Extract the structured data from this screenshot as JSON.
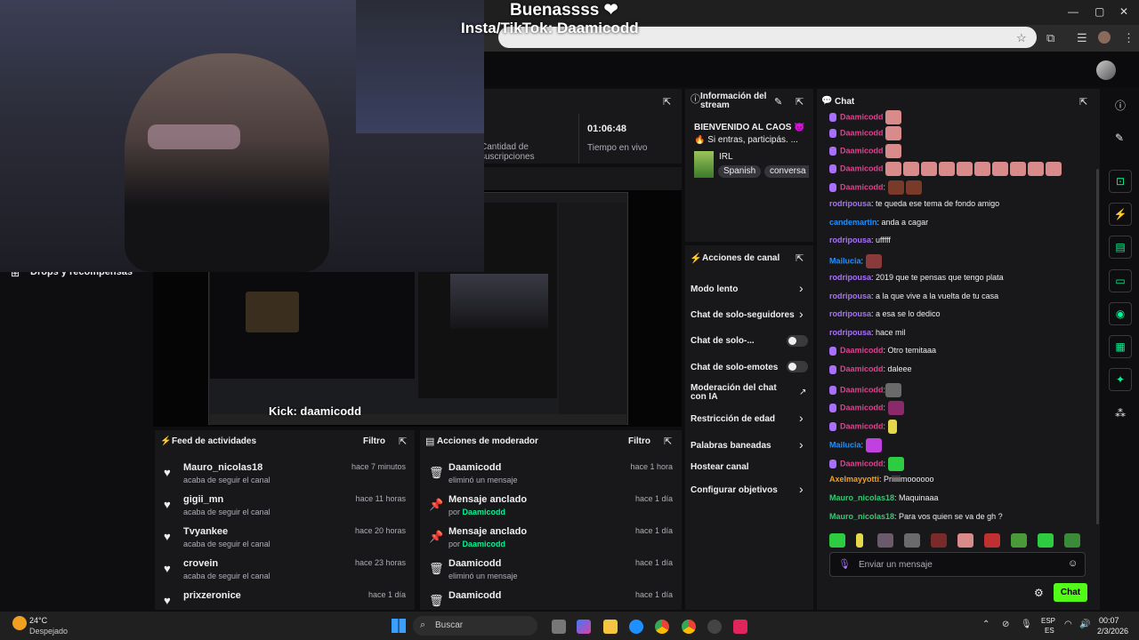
{
  "overlay": {
    "title": "Buenassss ❤",
    "social": "Insta/TikTok: Daamicodd"
  },
  "stream_stats": {
    "subs_label": "Cantidad de suscripciones",
    "live_time": "01:06:48",
    "live_time_label": "Tiempo en vivo"
  },
  "stream_info": {
    "title": "Información del stream",
    "stream_title": "BIENVENIDO AL CAOS 👿",
    "stream_sub": "🔥 Si entras, participás. ...",
    "category": "IRL",
    "tags": [
      "Spanish",
      "conversa"
    ]
  },
  "sidebar_left": {
    "drops": "Drops y recompensas"
  },
  "preview": {
    "kick_label": "Kick: daamicodd"
  },
  "channel_actions": {
    "title": "Acciones de canal",
    "items": [
      "Modo lento",
      "Chat de solo-seguidores",
      "Chat de solo-...",
      "Chat de solo-emotes",
      "Moderación del chat con IA",
      "Restricción de edad",
      "Palabras baneadas",
      "Hostear canal",
      "Configurar objetivos"
    ]
  },
  "activity_feed": {
    "title": "Feed de actividades",
    "filter": "Filtro",
    "items": [
      {
        "name": "Mauro_nicolas18",
        "sub": "acaba de seguir el canal",
        "time": "hace 7 minutos"
      },
      {
        "name": "gigii_mn",
        "sub": "acaba de seguir el canal",
        "time": "hace 11 horas"
      },
      {
        "name": "Tvyankee",
        "sub": "acaba de seguir el canal",
        "time": "hace 20 horas"
      },
      {
        "name": "crovein",
        "sub": "acaba de seguir el canal",
        "time": "hace 23 horas"
      },
      {
        "name": "prixzeronice",
        "sub": "",
        "time": "hace 1 día"
      }
    ]
  },
  "mod_actions": {
    "title": "Acciones de moderador",
    "filter": "Filtro",
    "items": [
      {
        "name": "Daamicodd",
        "sub": "eliminó un mensaje",
        "by": "",
        "time": "hace 1 hora"
      },
      {
        "name": "Mensaje anclado",
        "sub": "por ",
        "by": "Daamicodd",
        "time": "hace 1 día"
      },
      {
        "name": "Mensaje anclado",
        "sub": "por ",
        "by": "Daamicodd",
        "time": "hace 1 día"
      },
      {
        "name": "Daamicodd",
        "sub": "eliminó un mensaje",
        "by": "",
        "time": "hace 1 día"
      },
      {
        "name": "Daamicodd",
        "sub": "",
        "by": "",
        "time": "hace 1 día"
      }
    ]
  },
  "chat": {
    "title": "Chat",
    "input_placeholder": "Enviar un mensaje",
    "send_label": "Chat",
    "messages": [
      {
        "user": "Daamicodd",
        "text": "",
        "cls": "u1"
      },
      {
        "user": "Daamicodd",
        "text": "",
        "cls": "u1"
      },
      {
        "user": "Daamicodd",
        "text": "",
        "cls": "u1"
      },
      {
        "user": "Daamicodd",
        "text": "",
        "cls": "u1"
      },
      {
        "user": "rodripousa",
        "text": ": te queda ese tema de fondo amigo",
        "cls": "u2"
      },
      {
        "user": "candemartin",
        "text": ": anda a cagar",
        "cls": "u3"
      },
      {
        "user": "rodripousa",
        "text": ": ufffff",
        "cls": "u2"
      },
      {
        "user": "Mailucia",
        "text": ":",
        "cls": "u3"
      },
      {
        "user": "rodripousa",
        "text": ": 2019 que te pensas que tengo plata",
        "cls": "u2"
      },
      {
        "user": "rodripousa",
        "text": ": a la que vive a la vuelta de tu casa",
        "cls": "u2"
      },
      {
        "user": "rodripousa",
        "text": ": a esa se lo dedico",
        "cls": "u2"
      },
      {
        "user": "rodripousa",
        "text": ": hace mil",
        "cls": "u2"
      },
      {
        "user": "Daamicodd",
        "text": ": Otro temitaaa",
        "cls": "u1"
      },
      {
        "user": "Daamicodd",
        "text": ": daleee",
        "cls": "u1"
      },
      {
        "user": "Daamicodd",
        "text": ":",
        "cls": "u1"
      },
      {
        "user": "Daamicodd",
        "text": ":",
        "cls": "u1"
      },
      {
        "user": "Daamicodd",
        "text": ":",
        "cls": "u1"
      },
      {
        "user": "Mailucia",
        "text": ":",
        "cls": "u3"
      },
      {
        "user": "Daamicodd",
        "text": ":",
        "cls": "u1"
      },
      {
        "user": "Axelmayyotti",
        "text": ": Priiiiimoooooo",
        "cls": "u4"
      },
      {
        "user": "Mauro_nicolas18",
        "text": ": Maquinaaa",
        "cls": "u5"
      },
      {
        "user": "Mauro_nicolas18",
        "text": ": Para vos quien se va de gh ?",
        "cls": "u5"
      }
    ]
  },
  "taskbar": {
    "temp": "24°C",
    "weather": "Despejado",
    "search": "Buscar",
    "lang1": "ESP",
    "lang2": "ES",
    "time": "00:07",
    "date": "2/3/2026"
  },
  "colors": {
    "accent": "#53fc18",
    "bg": "#0e0e10",
    "panel": "#18181b"
  }
}
